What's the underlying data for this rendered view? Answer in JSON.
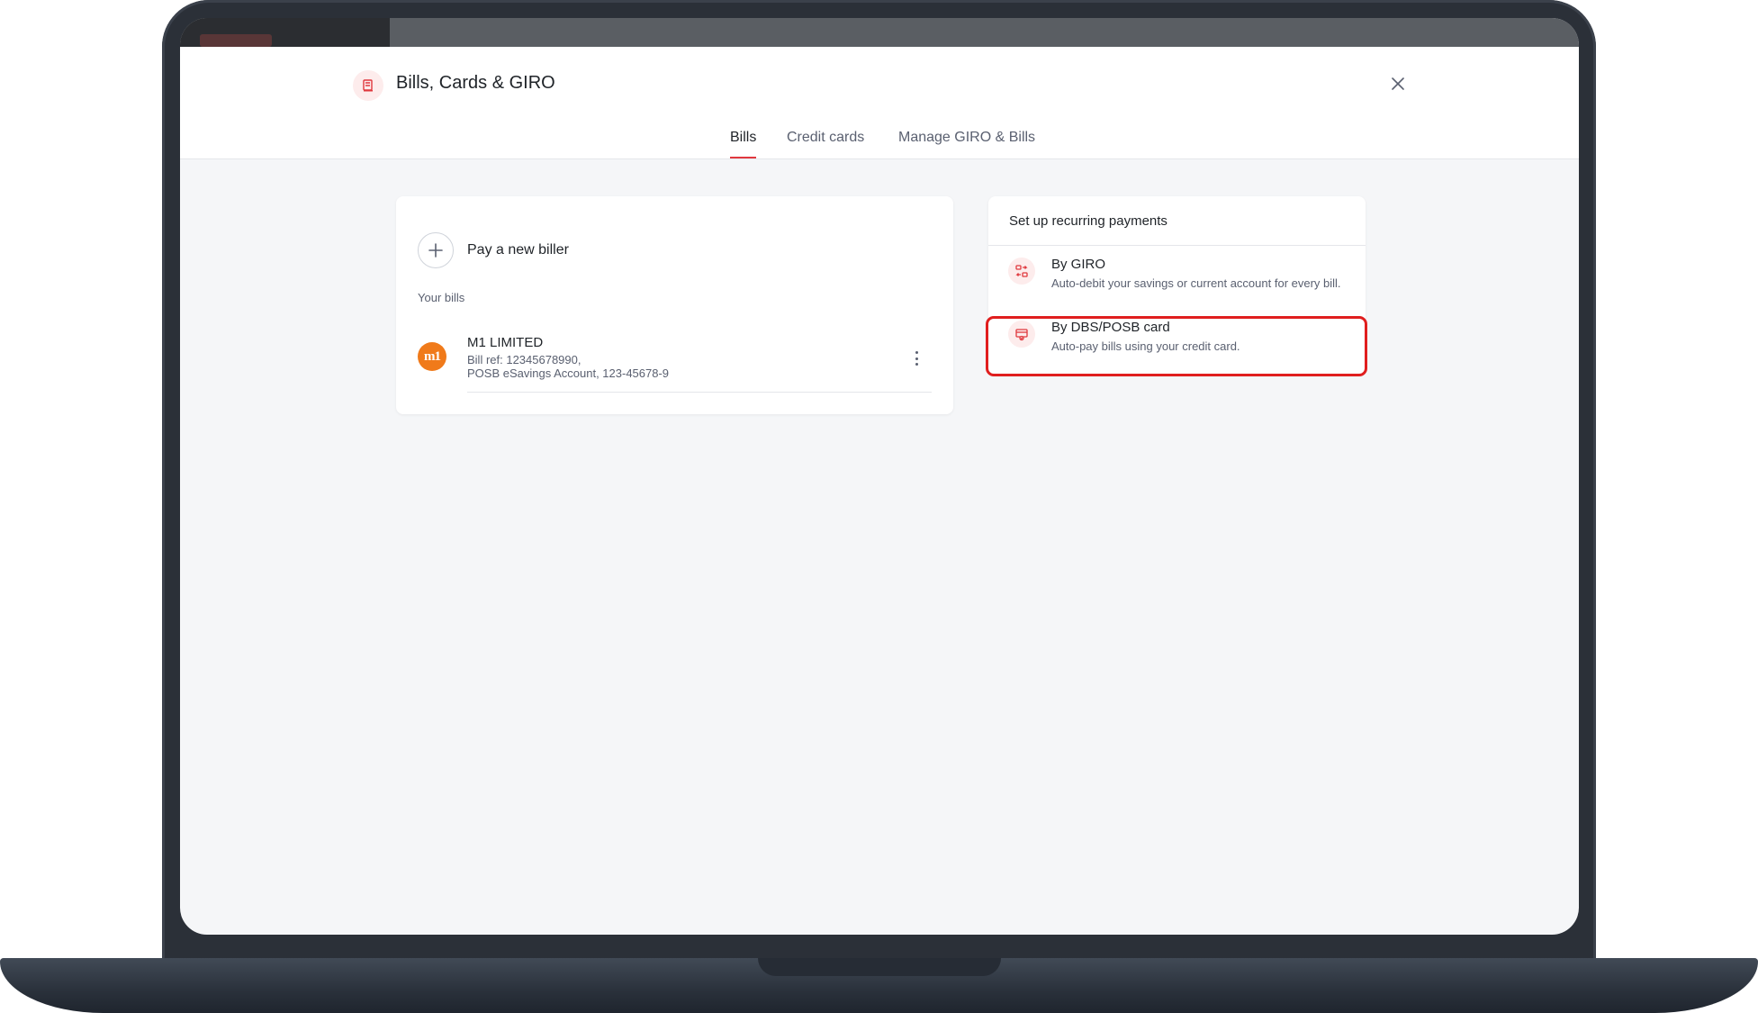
{
  "header": {
    "title": "Bills, Cards & GIRO",
    "title_icon": "bill-icon",
    "close_icon": "close-icon"
  },
  "tabs": [
    {
      "label": "Bills",
      "active": true
    },
    {
      "label": "Credit cards",
      "active": false
    },
    {
      "label": "Manage GIRO & Bills",
      "active": false
    }
  ],
  "bills": {
    "pay_new_label": "Pay a new biller",
    "section_label": "Your bills",
    "items": [
      {
        "name": "M1 LIMITED",
        "logo_text": "m1",
        "bill_ref": "Bill ref: 12345678990,",
        "account": "POSB eSavings Account, 123-45678-9"
      }
    ]
  },
  "recurring": {
    "title": "Set up recurring payments",
    "options": [
      {
        "title": "By GIRO",
        "description": "Auto-debit your savings or current account for every bill.",
        "icon": "giro-transfer-icon"
      },
      {
        "title": "By DBS/POSB card",
        "description": "Auto-pay bills using your credit card.",
        "icon": "card-icon",
        "highlighted": true
      }
    ]
  },
  "colors": {
    "accent": "#e0383e",
    "highlight": "#e01e1e",
    "biller_logo": "#f07a1a"
  }
}
